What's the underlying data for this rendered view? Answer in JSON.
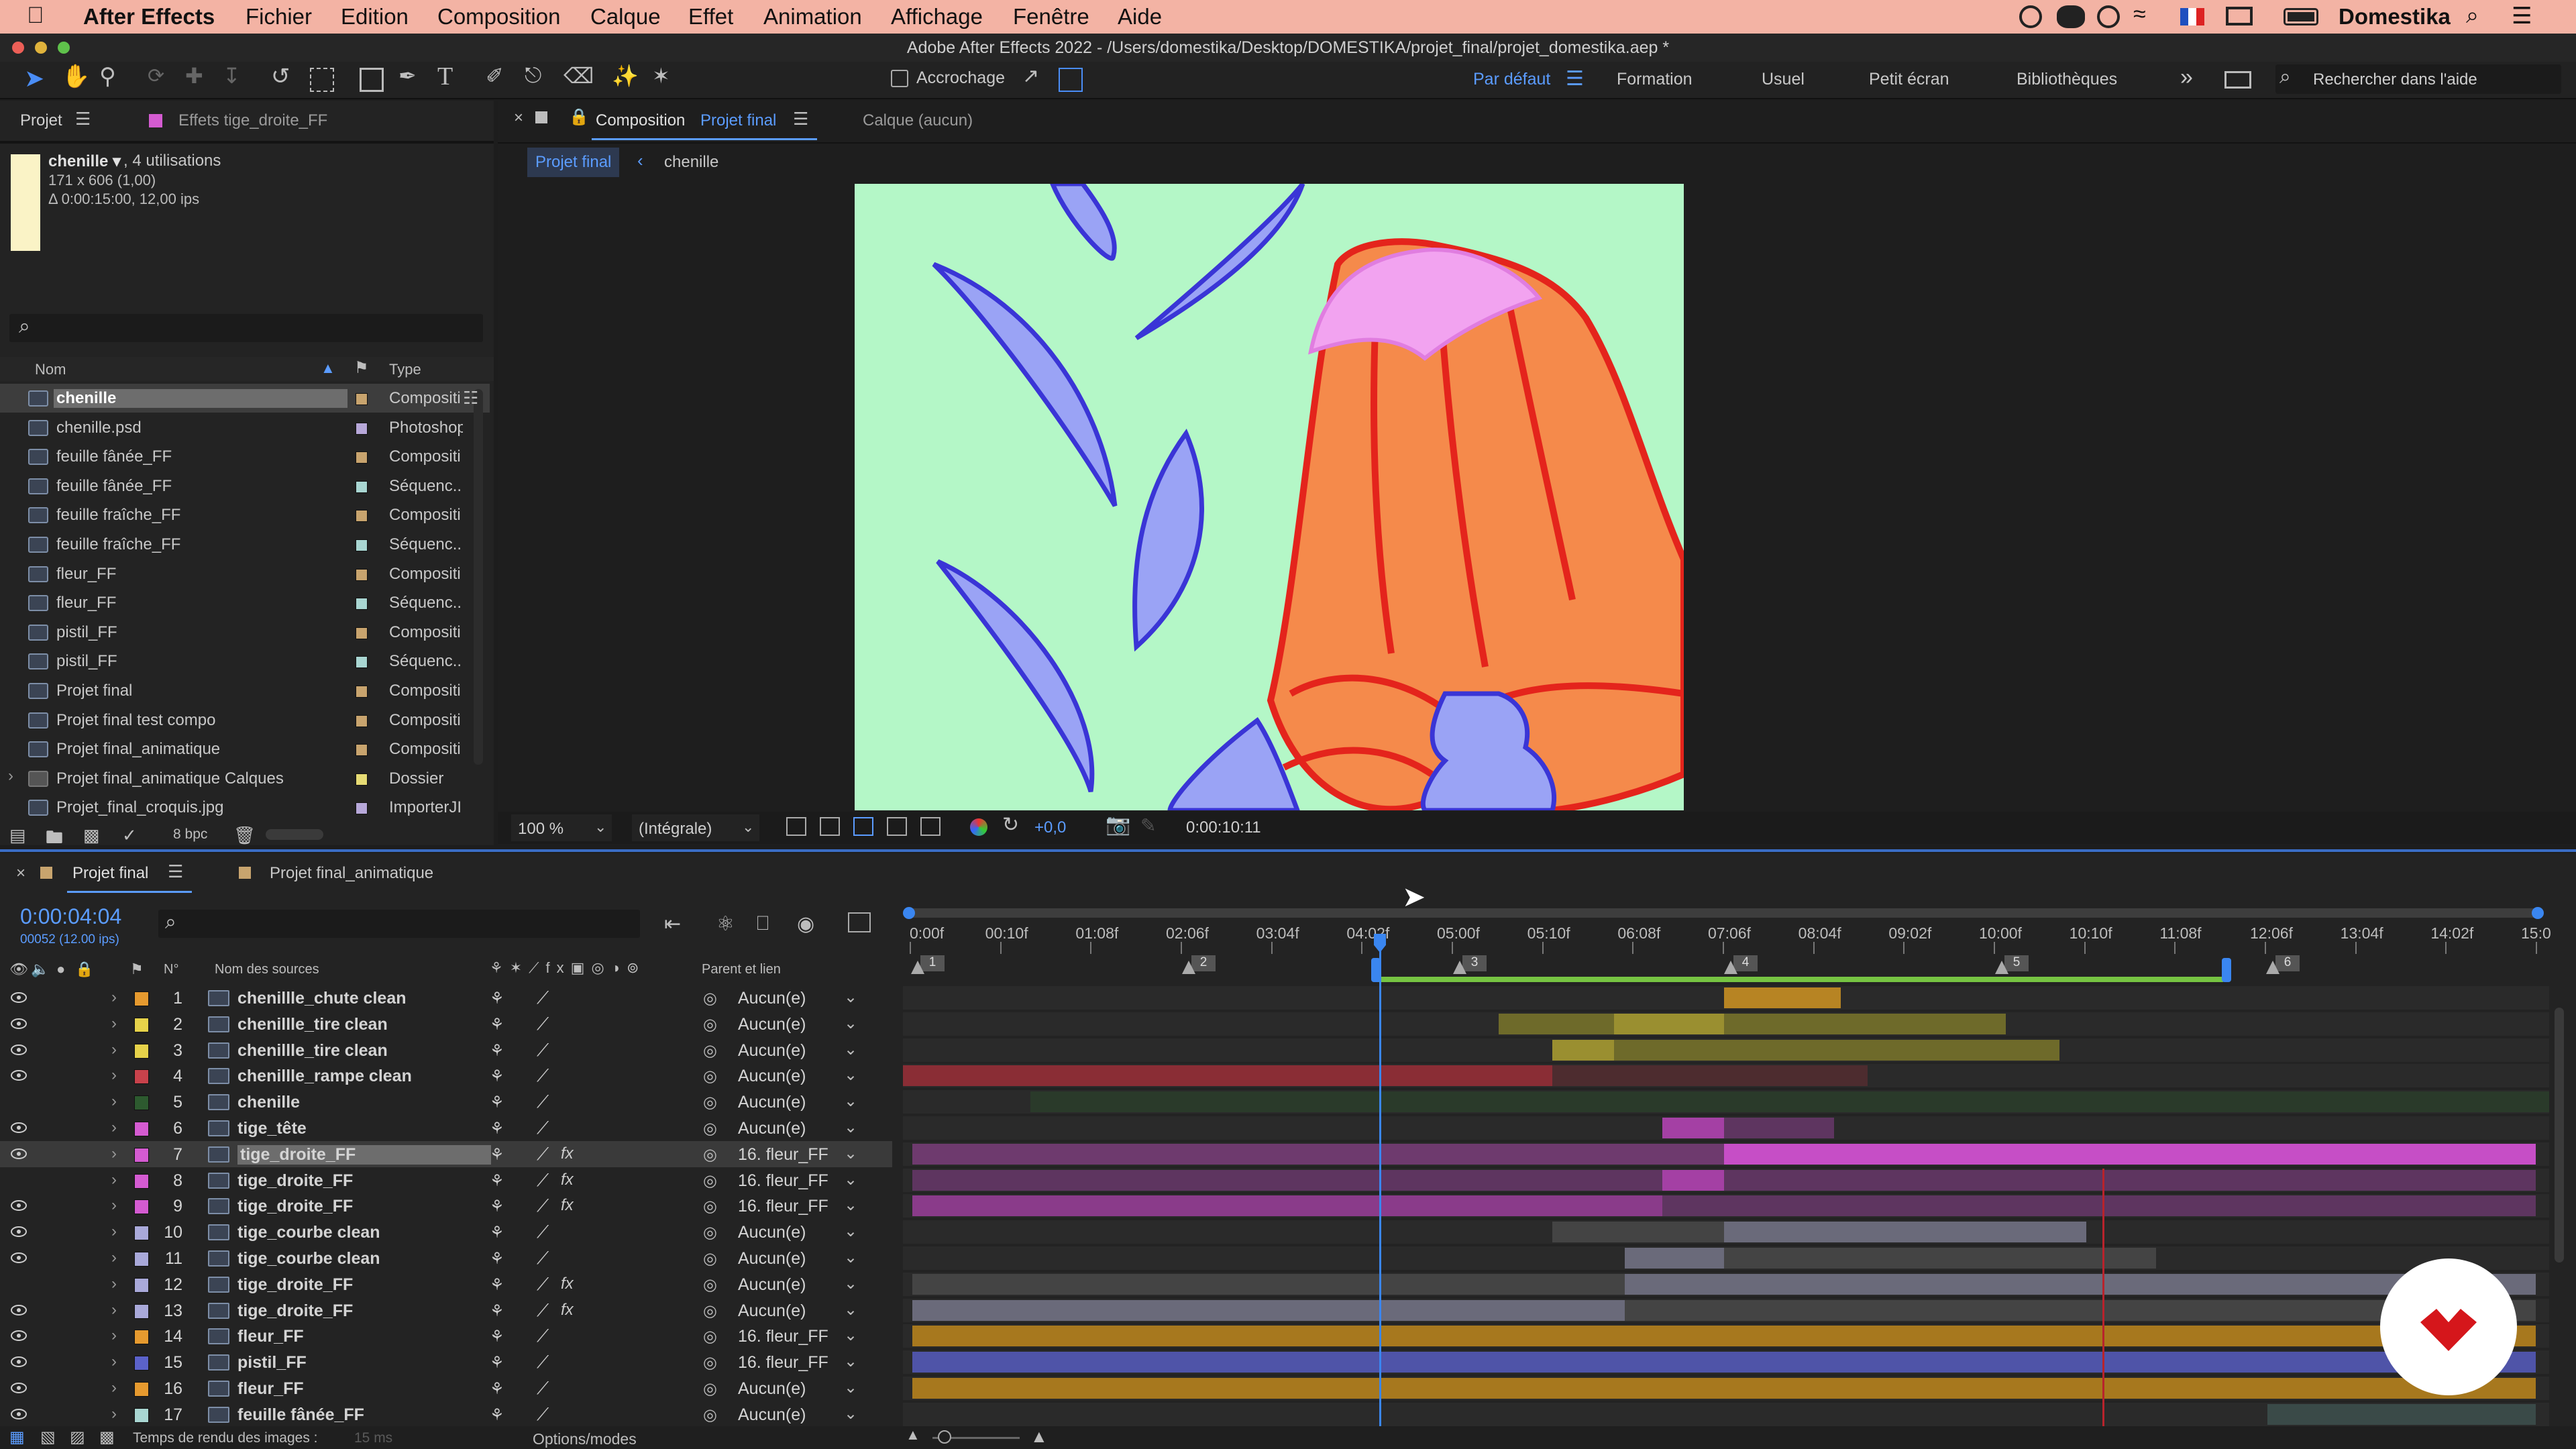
{
  "menubar": {
    "app": "After Effects",
    "items": [
      "Fichier",
      "Edition",
      "Composition",
      "Calque",
      "Effet",
      "Animation",
      "Affichage",
      "Fenêtre",
      "Aide"
    ],
    "user": "Domestika"
  },
  "window_title": "Adobe After Effects 2022 - /Users/domestika/Desktop/DOMESTIKA/projet_final/projet_domestika.aep *",
  "toolbar": {
    "snap_label": "Accrochage",
    "workspaces": [
      "Par défaut",
      "Formation",
      "Usuel",
      "Petit écran",
      "Bibliothèques"
    ],
    "more": "»",
    "help_search_placeholder": "Rechercher dans l'aide"
  },
  "project_panel": {
    "tab_project": "Projet",
    "tab_effects": "Effets tige_droite_FF",
    "selected_name": "chenille ▾",
    "selected_usage": ", 4 utilisations",
    "selected_dims": "171 x 606 (1,00)",
    "selected_duration": "Δ 0:00:15:00, 12,00 ips",
    "search_icon_text": "⌕",
    "col_name": "Nom",
    "col_type": "Type",
    "items": [
      {
        "name": "chenille",
        "type": "Compositi",
        "color": "#c8a46e",
        "selected": true
      },
      {
        "name": "chenille.psd",
        "type": "Photoshop",
        "color": "#b7a8d9"
      },
      {
        "name": "feuille fânée_FF",
        "type": "Compositi",
        "color": "#c8a46e"
      },
      {
        "name": "feuille fânée_FF",
        "type": "Séquenc...",
        "color": "#a9d6d2"
      },
      {
        "name": "feuille fraîche_FF",
        "type": "Compositi",
        "color": "#c8a46e"
      },
      {
        "name": "feuille fraîche_FF",
        "type": "Séquenc...",
        "color": "#a9d6d2"
      },
      {
        "name": "fleur_FF",
        "type": "Compositi",
        "color": "#c8a46e"
      },
      {
        "name": "fleur_FF",
        "type": "Séquenc...",
        "color": "#a9d6d2"
      },
      {
        "name": "pistil_FF",
        "type": "Compositi",
        "color": "#c8a46e"
      },
      {
        "name": "pistil_FF",
        "type": "Séquenc...",
        "color": "#a9d6d2"
      },
      {
        "name": "Projet final",
        "type": "Compositi",
        "color": "#c8a46e"
      },
      {
        "name": "Projet final test compo",
        "type": "Compositi",
        "color": "#c8a46e"
      },
      {
        "name": "Projet final_animatique",
        "type": "Compositi",
        "color": "#c8a46e"
      },
      {
        "name": "Projet final_animatique Calques",
        "type": "Dossier",
        "color": "#e6db74"
      },
      {
        "name": "Projet_final_croquis.jpg",
        "type": "ImporterJI",
        "color": "#b7a8d9"
      }
    ],
    "bpc": "8 bpc"
  },
  "comp_panel": {
    "tab_label": "Composition",
    "tab_comp": "Projet final",
    "layer_tab": "Calque (aucun)",
    "breadcrumb": [
      "Projet final",
      "chenille"
    ],
    "zoom": "100 %",
    "resolution": "(Intégrale)",
    "exposure": "+0,0",
    "timecode": "0:00:10:11"
  },
  "timeline": {
    "tab_active": "Projet final",
    "tab_other": "Projet final_animatique",
    "current_time": "0:00:04:04",
    "frame_info": "00052 (12.00 ips)",
    "col_num": "N°",
    "col_source": "Nom des sources",
    "col_parent": "Parent et lien",
    "ruler": [
      "0:00f",
      "00:10f",
      "01:08f",
      "02:06f",
      "03:04f",
      "04:02f",
      "05:00f",
      "05:10f",
      "06:08f",
      "07:06f",
      "08:04f",
      "09:02f",
      "10:00f",
      "10:10f",
      "11:08f",
      "12:06f",
      "13:04f",
      "14:02f",
      "15:0"
    ],
    "markers": [
      "1",
      "2",
      "3",
      "4",
      "5",
      "6"
    ],
    "layers": [
      {
        "num": "1",
        "name": "chenillle_chute clean",
        "color": "#e69a2f",
        "parent": "Aucun(e)",
        "fx": false,
        "eye": true
      },
      {
        "num": "2",
        "name": "chenillle_tire clean",
        "color": "#e6d24a",
        "parent": "Aucun(e)",
        "fx": false,
        "eye": true
      },
      {
        "num": "3",
        "name": "chenillle_tire clean",
        "color": "#e6d24a",
        "parent": "Aucun(e)",
        "fx": false,
        "eye": true
      },
      {
        "num": "4",
        "name": "chenillle_rampe clean",
        "color": "#c8424b",
        "parent": "Aucun(e)",
        "fx": false,
        "eye": true
      },
      {
        "num": "5",
        "name": "chenille",
        "color": "#2d5a2f",
        "parent": "Aucun(e)",
        "fx": false,
        "eye": false
      },
      {
        "num": "6",
        "name": "tige_tête",
        "color": "#d45bd1",
        "parent": "Aucun(e)",
        "fx": false,
        "eye": true
      },
      {
        "num": "7",
        "name": "tige_droite_FF",
        "color": "#d45bd1",
        "parent": "16. fleur_FF",
        "fx": true,
        "eye": true,
        "selected": true
      },
      {
        "num": "8",
        "name": "tige_droite_FF",
        "color": "#d45bd1",
        "parent": "16. fleur_FF",
        "fx": true,
        "eye": false
      },
      {
        "num": "9",
        "name": "tige_droite_FF",
        "color": "#d45bd1",
        "parent": "16. fleur_FF",
        "fx": true,
        "eye": true
      },
      {
        "num": "10",
        "name": "tige_courbe clean",
        "color": "#a9a9d9",
        "parent": "Aucun(e)",
        "fx": false,
        "eye": true
      },
      {
        "num": "11",
        "name": "tige_courbe clean",
        "color": "#a9a9d9",
        "parent": "Aucun(e)",
        "fx": false,
        "eye": true
      },
      {
        "num": "12",
        "name": "tige_droite_FF",
        "color": "#a9a9d9",
        "parent": "Aucun(e)",
        "fx": true,
        "eye": false
      },
      {
        "num": "13",
        "name": "tige_droite_FF",
        "color": "#a9a9d9",
        "parent": "Aucun(e)",
        "fx": true,
        "eye": true
      },
      {
        "num": "14",
        "name": "fleur_FF",
        "color": "#e69a2f",
        "parent": "16. fleur_FF",
        "fx": false,
        "eye": true
      },
      {
        "num": "15",
        "name": "pistil_FF",
        "color": "#5b62c9",
        "parent": "16. fleur_FF",
        "fx": false,
        "eye": true
      },
      {
        "num": "16",
        "name": "fleur_FF",
        "color": "#e69a2f",
        "parent": "Aucun(e)",
        "fx": false,
        "eye": true
      },
      {
        "num": "17",
        "name": "feuille fânée_FF",
        "color": "#a9d6d2",
        "parent": "Aucun(e)",
        "fx": false,
        "eye": true
      }
    ],
    "render_time": "Temps de rendu des images :",
    "render_value": "15 ms",
    "options": "Options/modes"
  }
}
